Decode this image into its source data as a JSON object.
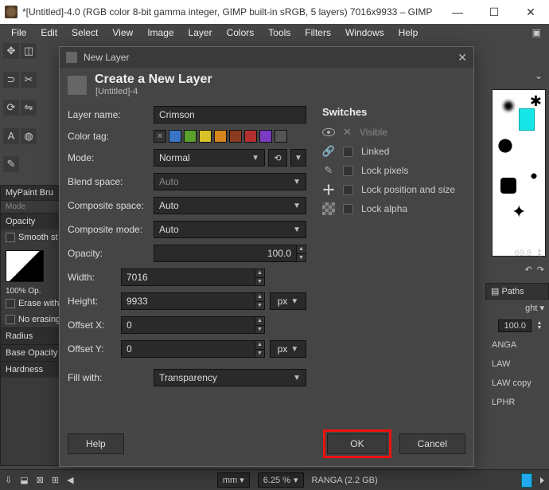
{
  "window": {
    "title": "*[Untitled]-4.0 (RGB color 8-bit gamma integer, GIMP built-in sRGB, 5 layers) 7016x9933 – GIMP"
  },
  "menu": {
    "items": [
      "File",
      "Edit",
      "Select",
      "View",
      "Image",
      "Layer",
      "Colors",
      "Tools",
      "Filters",
      "Windows",
      "Help"
    ]
  },
  "left_panel": {
    "tool_tab": "MyPaint Bru",
    "tool_sub": "Mode",
    "opacity_label": "Opacity",
    "smooth_label": "Smooth st",
    "swatch_label": "100% Op.",
    "erase_label": "Erase with",
    "noerase_label": "No erasing",
    "radius_label": "Radius",
    "baseop_label": "Base Opacity",
    "hardness_label": "Hardness"
  },
  "right_panel": {
    "value1": "69.8",
    "paths_tab": "Paths",
    "light_label": "ght ▾",
    "opacity_val": "100.0",
    "items": [
      "ANGA",
      "LAW",
      "LAW copy",
      "LPHR"
    ]
  },
  "dialog": {
    "title": "New Layer",
    "heading": "Create a New Layer",
    "subtitle": "[Untitled]-4",
    "labels": {
      "layer_name": "Layer name:",
      "color_tag": "Color tag:",
      "mode": "Mode:",
      "blend_space": "Blend space:",
      "composite_space": "Composite space:",
      "composite_mode": "Composite mode:",
      "opacity": "Opacity:",
      "width": "Width:",
      "height": "Height:",
      "offset_x": "Offset X:",
      "offset_y": "Offset Y:",
      "fill_with": "Fill with:"
    },
    "values": {
      "layer_name": "Crimson",
      "mode": "Normal",
      "blend_space": "Auto",
      "composite_space": "Auto",
      "composite_mode": "Auto",
      "opacity": "100.0",
      "width": "7016",
      "height": "9933",
      "offset_x": "0",
      "offset_y": "0",
      "fill_with": "Transparency",
      "unit": "px"
    },
    "color_tags": [
      "#333333",
      "#3a74c4",
      "#5aa02c",
      "#d8c22a",
      "#d8861f",
      "#8a3a1f",
      "#b43030",
      "#7a3ac4",
      "#555555"
    ],
    "switches": {
      "heading": "Switches",
      "visible": "Visible",
      "linked": "Linked",
      "lock_pixels": "Lock pixels",
      "lock_position": "Lock position and size",
      "lock_alpha": "Lock alpha"
    },
    "buttons": {
      "help": "Help",
      "ok": "OK",
      "cancel": "Cancel"
    }
  },
  "status": {
    "unit_dd": "mm ▾",
    "zoom": "6.25 %",
    "doc_info": "RANGA (2.2 GB)"
  }
}
